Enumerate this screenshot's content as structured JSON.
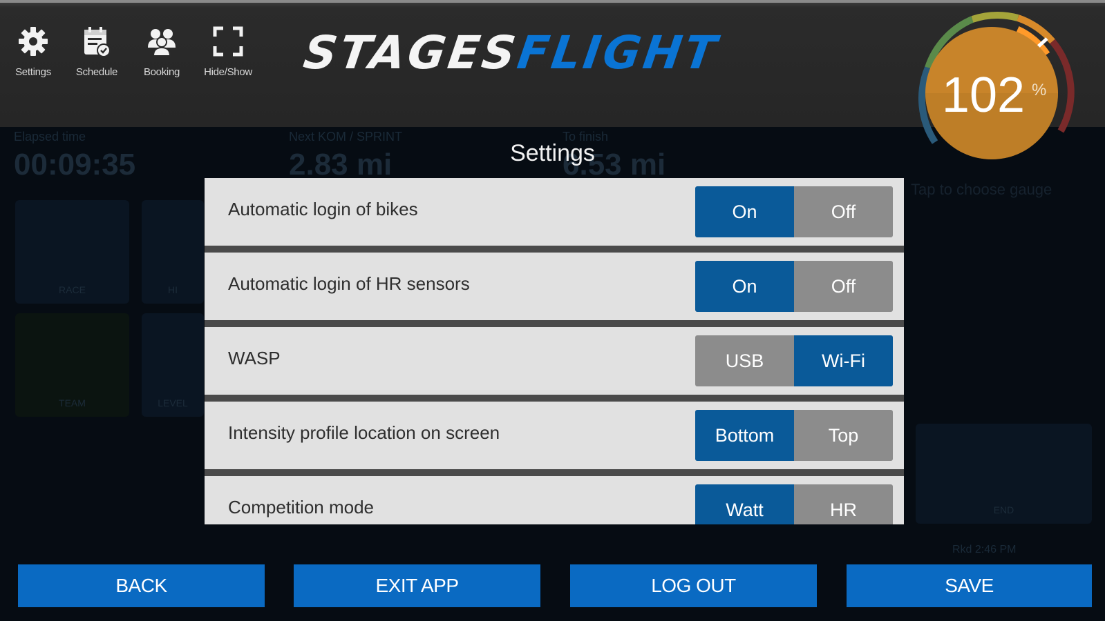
{
  "toolbar": {
    "items": [
      {
        "label": "Settings",
        "icon": "gear-icon"
      },
      {
        "label": "Schedule",
        "icon": "schedule-icon"
      },
      {
        "label": "Booking",
        "icon": "booking-icon"
      },
      {
        "label": "Hide/Show",
        "icon": "fullscreen-icon"
      }
    ]
  },
  "logo": {
    "part1": "STAGES",
    "part2": "FLIGHT"
  },
  "gauge": {
    "value": "102",
    "unit": "%",
    "level_percent": 102
  },
  "background": {
    "elapsed_label": "Elapsed time",
    "elapsed_value": "00:09:35",
    "next_label": "Next KOM / SPRINT",
    "next_value": "2.83 mi",
    "finish_label": "To finish",
    "finish_value": "6.53 mi",
    "gauge_hint": "Tap to choose gauge",
    "tile_labels": [
      "RACE",
      "HI",
      "TEAM",
      "LEVEL",
      "END"
    ],
    "extra_text": "Rkd 2:46 PM"
  },
  "dialog": {
    "title": "Settings",
    "rows": [
      {
        "label": "Automatic login of bikes",
        "options": [
          "On",
          "Off"
        ],
        "selected": 0
      },
      {
        "label": "Automatic login of HR sensors",
        "options": [
          "On",
          "Off"
        ],
        "selected": 0
      },
      {
        "label": "WASP",
        "options": [
          "USB",
          "Wi-Fi"
        ],
        "selected": 1
      },
      {
        "label": "Intensity profile location on screen",
        "options": [
          "Bottom",
          "Top"
        ],
        "selected": 0
      },
      {
        "label": "Competition mode",
        "options": [
          "Watt",
          "HR"
        ],
        "selected": 0
      }
    ]
  },
  "buttons": {
    "back": "BACK",
    "exit": "EXIT APP",
    "logout": "LOG OUT",
    "save": "SAVE"
  },
  "colors": {
    "accent": "#0a6ac2",
    "toggle_active": "#0a5a99",
    "toggle_inactive": "#8c8c8c",
    "gauge_fill": "#c8842a"
  }
}
